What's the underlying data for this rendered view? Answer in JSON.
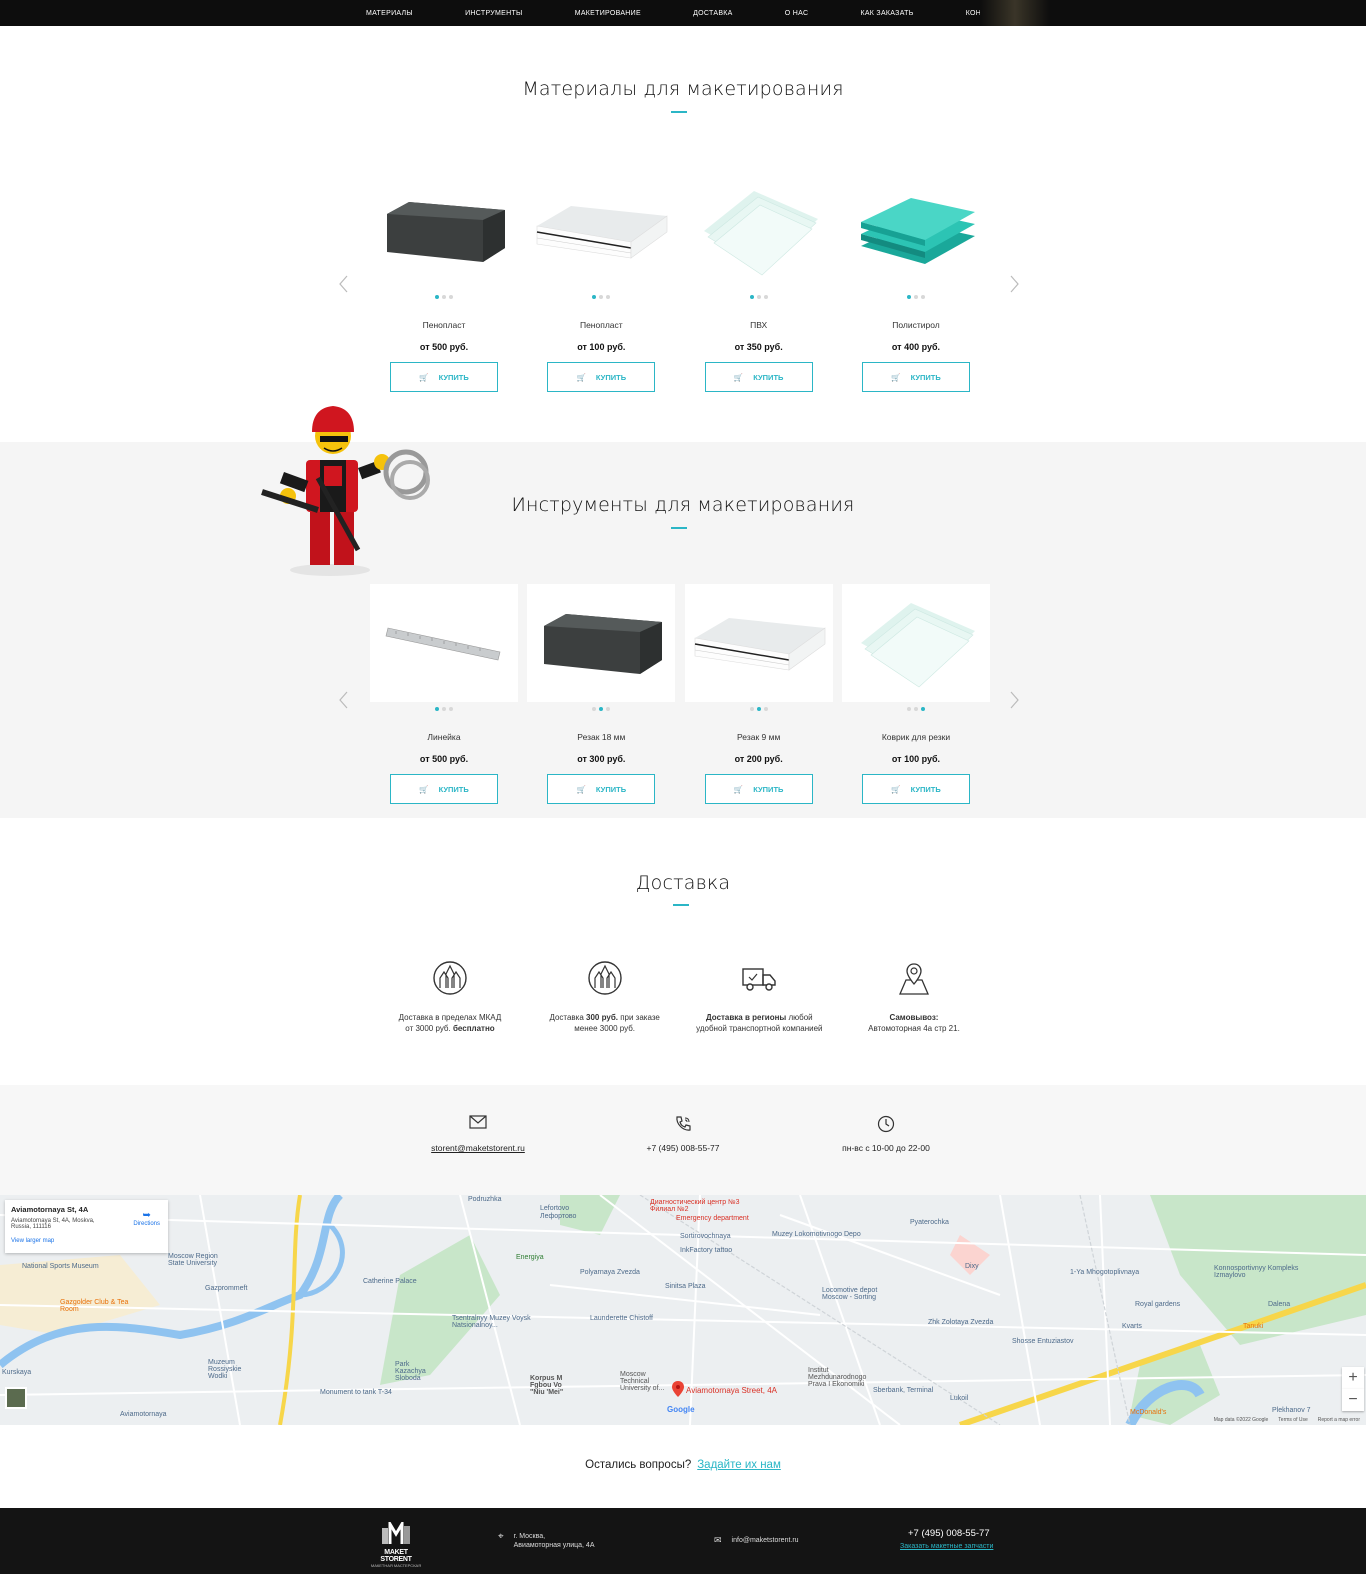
{
  "nav": {
    "items": [
      "Материалы",
      "Инструменты",
      "Макетирование",
      "Доставка",
      "О нас",
      "Как заказать",
      "Контакты"
    ]
  },
  "materials": {
    "title": "Материалы для макетирования",
    "buy_label": "КУПИТЬ",
    "products": [
      {
        "name": "Пенопласт",
        "price": "от 500 руб."
      },
      {
        "name": "Пенопласт",
        "price": "от 100 руб."
      },
      {
        "name": "ПВХ",
        "price": "от 350 руб."
      },
      {
        "name": "Полистирол",
        "price": "от 400 руб."
      }
    ]
  },
  "tools": {
    "title": "Инструменты для макетирования",
    "buy_label": "КУПИТЬ",
    "products": [
      {
        "name": "Линейка",
        "price": "от 500 руб."
      },
      {
        "name": "Резак 18 мм",
        "price": "от 300 руб."
      },
      {
        "name": "Резак 9 мм",
        "price": "от 200 руб."
      },
      {
        "name": "Коврик для резки",
        "price": "от 100 руб."
      }
    ]
  },
  "delivery": {
    "title": "Доставка",
    "items": [
      {
        "line1": "Доставка в пределах МКАД",
        "line2a": "от 3000 руб. ",
        "line2b": "бесплатно"
      },
      {
        "line1a": "Доставка ",
        "line1b": "300 руб.",
        "line1c": " при заказе",
        "line2": "менее 3000 руб."
      },
      {
        "line1a": "Доставка в регионы",
        "line1b": " любой",
        "line2": "удобной транспортной компанией"
      },
      {
        "line1": "Самовывоз:",
        "line2": "Автомоторная 4а стр 21."
      }
    ]
  },
  "contacts": {
    "email": "storent@maketstorent.ru",
    "phone": "+7 (495) 008-55-77",
    "hours": "пн-вс с 10-00 до 22-00"
  },
  "map": {
    "card_title": "Aviamotornaya St, 4A",
    "card_address": "Aviamotornaya St, 4A, Moskva, Russia, 111116",
    "directions": "Directions",
    "larger_map": "View larger map",
    "pin_label": "Aviamotornaya Street, 4A",
    "labels": [
      "Podruzhka",
      "Lefortovo",
      "Лефортово",
      "Moscow Region State University",
      "National Sports Museum",
      "Gazgolder Club & Tea Room",
      "Gazprommeft",
      "Catherine Palace",
      "Energiya",
      "Polyarnaya Zvezda",
      "Tsentralnyy Muzey Voysk Natsionalnoy...",
      "Launderette Chistoff",
      "Sinitsa Plaza",
      "Sortirovochnaya",
      "Muzey Lokomotivnogo Depo",
      "InkFactory tattoo",
      "Pyaterochka",
      "Dixy",
      "Locomotive depot Moscow - Sorting",
      "Zhk Zolotaya Zvezda",
      "Shosse Entuziastov",
      "Royal gardens",
      "Kvarts",
      "Tanuki",
      "Dalena",
      "Korpus M Fgbou Vo \"Niu 'Mei\"",
      "Moscow Technical University of...",
      "Institut Mezhdunarodnogo Prava I Ekonomiki",
      "Sberbank, Terminal",
      "Lukoil",
      "Park Kazachya Sloboda",
      "Muzeum Rossiyskie Wodki",
      "Monument to tank T-34",
      "Aviamotornaya",
      "Kurskaya",
      "Plekhanov 7",
      "McDonald's",
      "Konnosportivnyy Kompleks Izmaylovo",
      "Диагностический центр №3 Филиал №2",
      "Emergency department",
      "1-Ya Mhogotoplivnaya"
    ],
    "attribution": [
      "Map data ©2022 Google",
      "Terms of Use",
      "Report a map error"
    ],
    "google": "Google"
  },
  "question": {
    "text": "Остались вопросы?",
    "link": "Задайте их нам"
  },
  "footer": {
    "logo_main": "MAKET STORENT",
    "logo_sub": "МАКЕТНАЯ МАСТЕРСКАЯ",
    "address_line1": "г. Москва,",
    "address_line2": "Авиамоторная улица, 4А",
    "email": "info@maketstorent.ru",
    "phone": "+7 (495) 008-55-77",
    "request": "Заказать макетные запчасти"
  },
  "colors": {
    "accent": "#2bb6c6",
    "nav_bg": "#0d0d0d",
    "footer_bg": "#141414"
  }
}
